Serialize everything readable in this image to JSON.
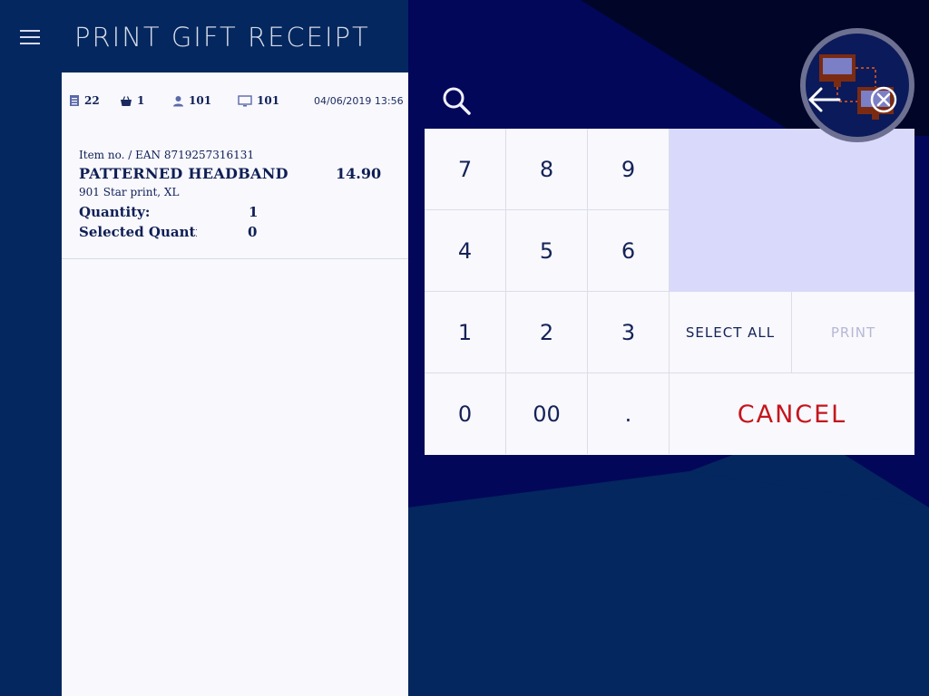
{
  "header": {
    "title": "PRINT GIFT RECEIPT",
    "menu_icon": "hamburger-menu-icon"
  },
  "status_bar": {
    "document_count": "22",
    "basket_count": "1",
    "user_id": "101",
    "terminal_id": "101",
    "datetime": "04/06/2019 13:56"
  },
  "item": {
    "ean_line": "Item no. / EAN 8719257316131",
    "name": "PATTERNED HEADBAND",
    "price": "14.90",
    "variant": "901 Star print, XL",
    "quantity_label": "Quantity:",
    "quantity_value": "1",
    "selected_quantity_label": "Selected Quantity",
    "selected_quantity_value": "0"
  },
  "keypad": {
    "keys": [
      "7",
      "8",
      "9",
      "4",
      "5",
      "6",
      "1",
      "2",
      "3",
      "0",
      "00",
      "."
    ],
    "select_all_label": "SELECT ALL",
    "print_label": "PRINT",
    "cancel_label": "CANCEL"
  },
  "colors": {
    "background": "#0b1a5a",
    "panel": "#f8f8fd",
    "text_dark": "#0f1f55",
    "cancel_red": "#c4161c",
    "display_lilac": "#d9d9fb",
    "disabled_text": "#b6b8d4"
  }
}
